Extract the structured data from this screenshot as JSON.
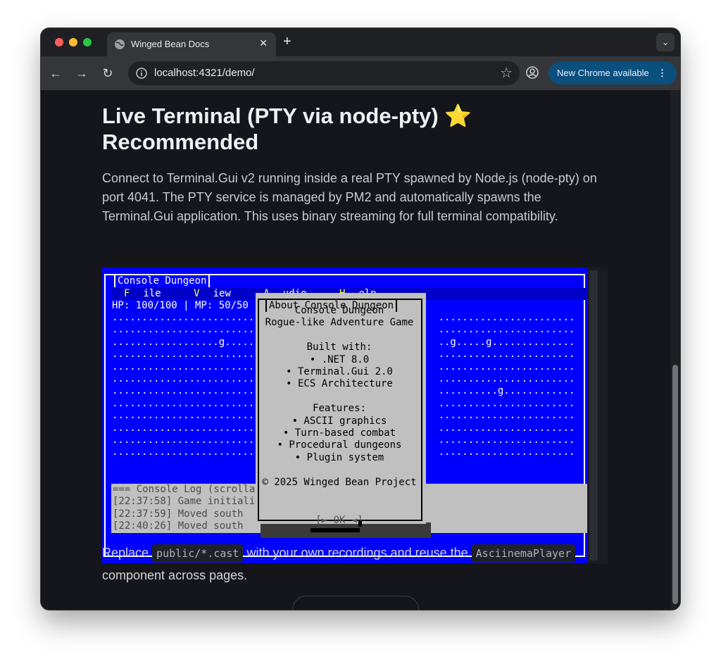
{
  "browser": {
    "tab_title": "Winged Bean Docs",
    "tab_close": "✕",
    "new_tab": "+",
    "url": "localhost:4321/demo/",
    "update_button": "New Chrome available",
    "update_menu": "⋮"
  },
  "page": {
    "heading": "Live Terminal (PTY via node-pty)",
    "heading_emoji": "⭐",
    "heading_line2": "Recommended",
    "intro": "Connect to Terminal.Gui v2 running inside a real PTY spawned by Node.js (node-pty) on port 4041. The PTY service is managed by PM2 and automatically spawns the Terminal.Gui application. This uses binary streaming for full terminal compatibility.",
    "footer_before": "Replace ",
    "footer_code1": "public/*.cast",
    "footer_middle": " with your own recordings and reuse the ",
    "footer_code2": "AsciinemaPlayer",
    "footer_after": "component across pages."
  },
  "terminal": {
    "window_title": "Console Dungeon",
    "menu": [
      {
        "hot": "F",
        "rest": "ile"
      },
      {
        "hot": "V",
        "rest": "iew"
      },
      {
        "hot": "A",
        "rest": "udio"
      },
      {
        "hot": "H",
        "rest": "elp"
      }
    ],
    "status": "HP: 100/100 | MP: 50/50",
    "map_rows": [
      "...........................                            .......................",
      "...........................                            .......................",
      "..................g........                            ..g.....g..............",
      "...........................                            .......................",
      "...........................                            .......................",
      "...........................                            .......................",
      "...........................                            ..........g............",
      "...........................                            .......................",
      "...........................                            .......................",
      "...........................                            .......................",
      "...........................                            .......................",
      "...........................                            ......................."
    ],
    "log_lines": [
      "=== Console Log (scrolla",
      "[22:37:58] Game initiali",
      "[22:37:59] Moved south",
      "[22:40:26] Moved south"
    ],
    "dialog": {
      "title": "About Console Dungeon",
      "lines": [
        "Console Dungeon",
        "Rogue-like Adventure Game",
        "",
        "Built with:",
        "• .NET 8.0",
        "• Terminal.Gui 2.0",
        "• ECS Architecture",
        "",
        "Features:",
        "• ASCII graphics",
        "• Turn-based combat",
        "• Procedural dungeons",
        "• Plugin system",
        "",
        "© 2025 Winged Bean Project"
      ],
      "ok_button": "[► OK ◄]"
    }
  }
}
